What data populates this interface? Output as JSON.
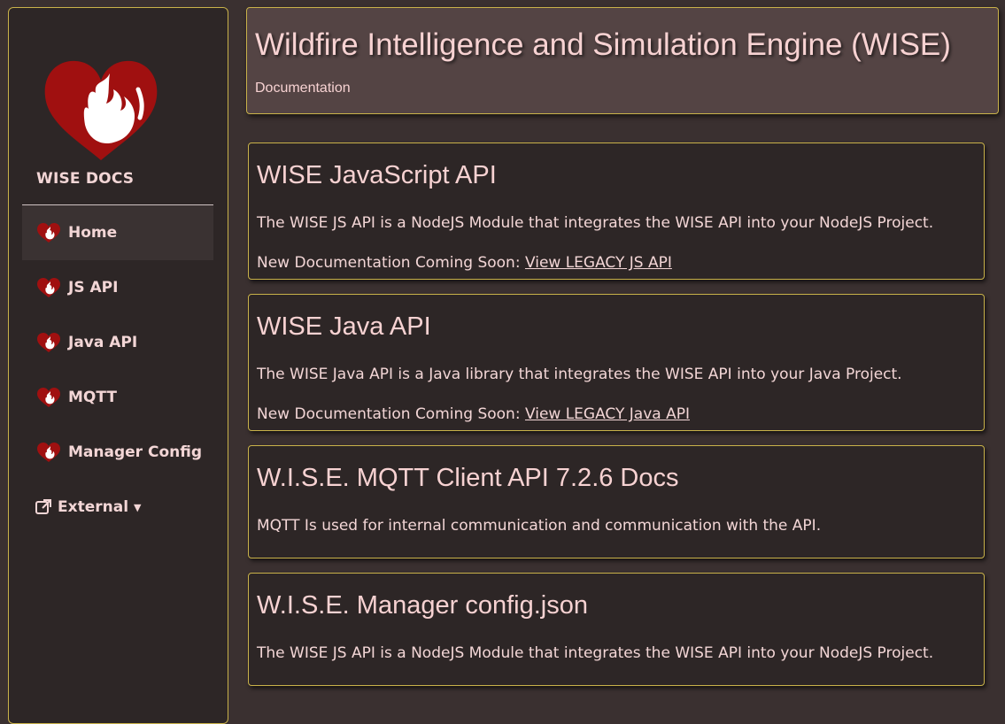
{
  "sidebar": {
    "brand": "WISE DOCS",
    "items": [
      {
        "label": "Home",
        "icon": "wise-heart-icon"
      },
      {
        "label": "JS API",
        "icon": "wise-heart-icon"
      },
      {
        "label": "Java API",
        "icon": "wise-heart-icon"
      },
      {
        "label": "MQTT",
        "icon": "wise-heart-icon"
      },
      {
        "label": "Manager Config",
        "icon": "wise-heart-icon"
      }
    ],
    "external": {
      "label": "External",
      "icon": "external-link-icon"
    }
  },
  "header": {
    "title": "Wildfire Intelligence and Simulation Engine (WISE)",
    "subtitle": "Documentation"
  },
  "cards": [
    {
      "title": "WISE JavaScript API",
      "description": "The WISE JS API is a NodeJS Module that integrates the WISE API into your NodeJS Project.",
      "legacy_prefix": "New Documentation Coming Soon: ",
      "legacy_link": "View LEGACY JS API"
    },
    {
      "title": "WISE Java API",
      "description": "The WISE Java API is a Java library that integrates the WISE API into your Java Project.",
      "legacy_prefix": "New Documentation Coming Soon: ",
      "legacy_link": "View LEGACY Java API"
    },
    {
      "title": "W.I.S.E. MQTT Client API 7.2.6 Docs",
      "description": "MQTT Is used for internal communication and communication with the API."
    },
    {
      "title": "W.I.S.E. Manager config.json",
      "description": "The WISE JS API is a NodeJS Module that integrates the WISE API into your NodeJS Project."
    }
  ],
  "colors": {
    "accent_border": "#c9b24a",
    "logo_red": "#a01010",
    "text": "#f3d6d6"
  }
}
